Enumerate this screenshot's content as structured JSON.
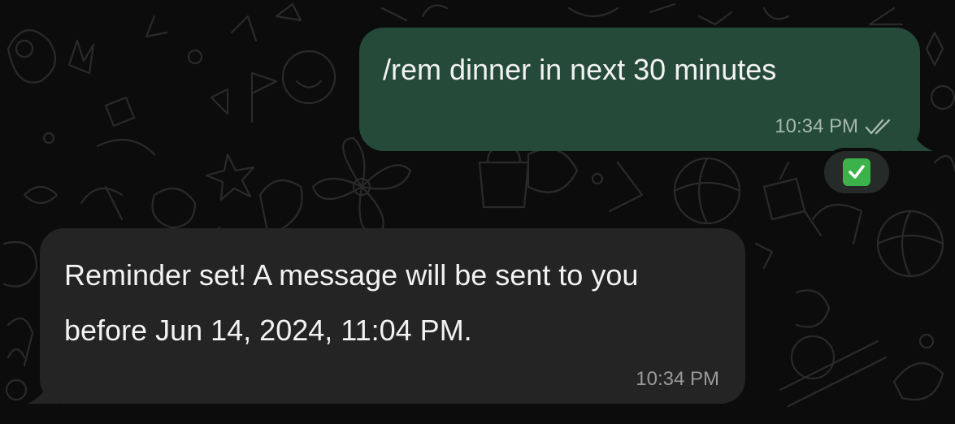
{
  "chat": {
    "outgoing": {
      "text": "/rem dinner in next 30 minutes",
      "time": "10:34 PM",
      "status_icon": "double-check-icon",
      "reaction_icon": "check-mark-button-emoji"
    },
    "incoming": {
      "text": "Reminder set! A message will be sent to you before Jun 14, 2024, 11:04 PM.",
      "time": "10:34 PM"
    }
  },
  "colors": {
    "background": "#0c0c0c",
    "outgoing_bubble": "#254a3a",
    "incoming_bubble": "#242424",
    "reaction_green": "#3bb34a"
  }
}
